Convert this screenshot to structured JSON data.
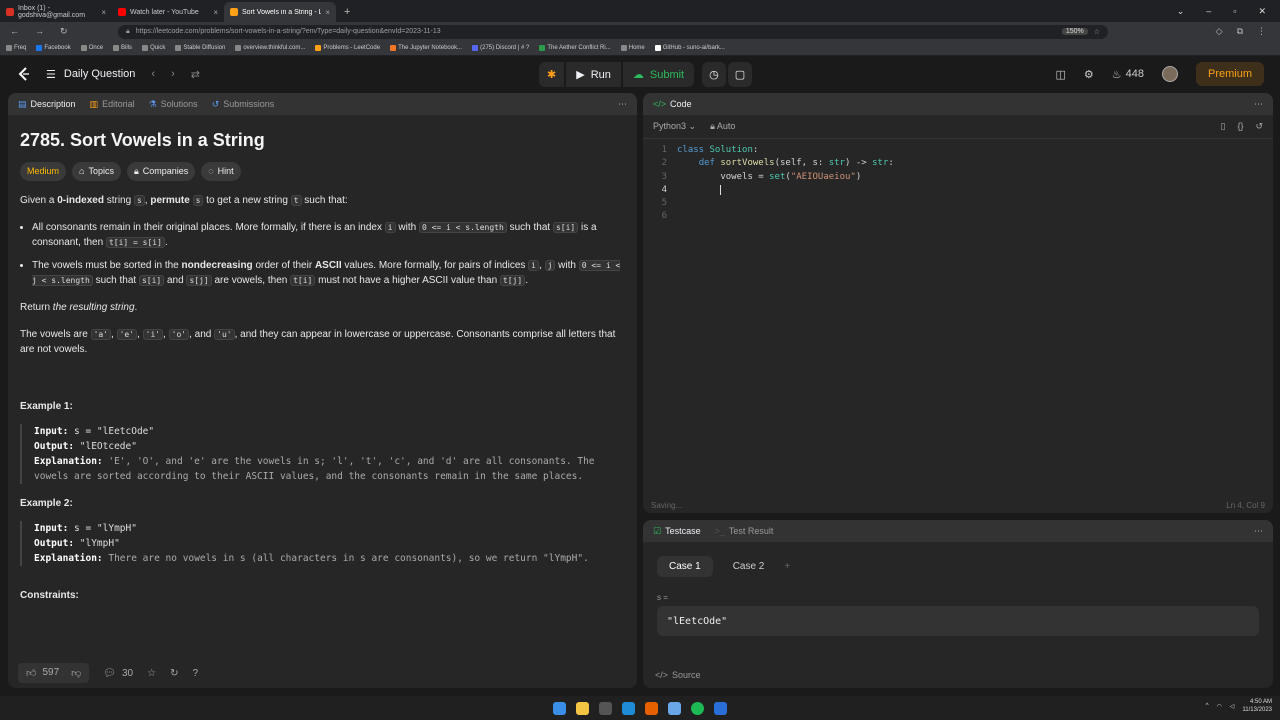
{
  "browser": {
    "tabs": [
      {
        "label": "Inbox (1) - godshiva@gmail.com",
        "color": "#d93025",
        "active": false
      },
      {
        "label": "Watch later - YouTube",
        "color": "#ff0000",
        "active": false
      },
      {
        "label": "Sort Vowels in a String - LeetCode",
        "color": "#ffa116",
        "active": true
      }
    ],
    "url": "https://leetcode.com/problems/sort-vowels-in-a-string/?envType=daily-question&envId=2023-11-13",
    "zoom": "150%",
    "bookmarks": [
      "Freq",
      "Facebook",
      "Once",
      "Bills",
      "Quick",
      "Stable Diffusion",
      "overview.thinkful.com...",
      "Problems - LeetCode",
      "The Jupyter Notebook...",
      "(275) Discord | # ?",
      "The Aether Conflict Ri...",
      "Home",
      "GitHub - suno-ai/bark..."
    ]
  },
  "topbar": {
    "daily_label": "Daily Question",
    "run_label": "Run",
    "submit_label": "Submit",
    "streak": "448",
    "premium_label": "Premium"
  },
  "left_tabs": [
    "Description",
    "Editorial",
    "Solutions",
    "Submissions"
  ],
  "problem": {
    "title": "2785. Sort Vowels in a String",
    "difficulty": "Medium",
    "tag_topics": "Topics",
    "tag_companies": "Companies",
    "tag_hint": "Hint",
    "intro_pre": "Given a ",
    "intro_b1": "0-indexed",
    "intro_mid": " string ",
    "intro_s": "s",
    "intro_comma": ", ",
    "intro_b2": "permute",
    "intro_s2": "s",
    "intro_to": " to get a new string ",
    "intro_t": "t",
    "intro_end": " such that:",
    "b1_pre": "All consonants remain in their original places. More formally, if there is an index ",
    "b1_i": "i",
    "b1_with": " with ",
    "b1_cond": "0 <= i < s.length",
    "b1_such": " such that ",
    "b1_si": "s[i]",
    "b1_is": " is a consonant, then ",
    "b1_eq": "t[i] = s[i]",
    "b1_dot": ".",
    "b2_pre": "The vowels must be sorted in the ",
    "b2_bold": "nondecreasing",
    "b2_mid": " order of their ",
    "b2_ascii": "ASCII",
    "b2_rest": " values. More formally, for pairs of indices ",
    "b2_i": "i",
    "b2_comma": ", ",
    "b2_j": "j",
    "b2_with": " with ",
    "b2_cond": "0 <= i < j < s.length",
    "b2_such": " such that ",
    "b2_si": "s[i]",
    "b2_and": " and ",
    "b2_sj": "s[j]",
    "b2_are": " are vowels, then ",
    "b2_ti": "t[i]",
    "b2_must": " must not have a higher ASCII value than ",
    "b2_tj": "t[j]",
    "b2_dot": ".",
    "return_pre": "Return ",
    "return_em": "the resulting string",
    "return_dot": ".",
    "vowels_pre": "The vowels are ",
    "v_a": "'a'",
    "v_e": "'e'",
    "v_i": "'i'",
    "v_o": "'o'",
    "v_u": "'u'",
    "sep1": ", ",
    "sep2": ", ",
    "sep3": ", ",
    "and": ", and ",
    "vowels_post": ", and they can appear in lowercase or uppercase. Consonants comprise all letters that are not vowels.",
    "ex1_title": "Example 1:",
    "ex1_input_label": "Input:",
    "ex1_input": " s = \"lEetcOde\"",
    "ex1_output_label": "Output:",
    "ex1_output": " \"lEOtcede\"",
    "ex1_expl_label": "Explanation:",
    "ex1_expl": " 'E', 'O', and 'e' are the vowels in s; 'l', 't', 'c', and 'd' are all consonants. The vowels are sorted according to their ASCII values, and the consonants remain in the same places.",
    "ex2_title": "Example 2:",
    "ex2_input_label": "Input:",
    "ex2_input": " s = \"lYmpH\"",
    "ex2_output_label": "Output:",
    "ex2_output": " \"lYmpH\"",
    "ex2_expl_label": "Explanation:",
    "ex2_expl": " There are no vowels in s (all characters in s are consonants), so we return \"lYmpH\".",
    "constraints": "Constraints:",
    "likes": "597",
    "comments": "30"
  },
  "code_panel": {
    "title": "Code",
    "language": "Python3",
    "mode": "Auto",
    "status_left": "Saving...",
    "status_right": "Ln 4, Col 9",
    "line_numbers": [
      "1",
      "2",
      "3",
      "4",
      "5",
      "6"
    ]
  },
  "testcase_panel": {
    "tab1": "Testcase",
    "tab2": "Test Result",
    "case1": "Case 1",
    "case2": "Case 2",
    "var_label": "s =",
    "var_value": "\"lEetcOde\"",
    "source": "Source"
  },
  "tray": {
    "time": "4:50 AM",
    "date": "11/13/2023"
  }
}
